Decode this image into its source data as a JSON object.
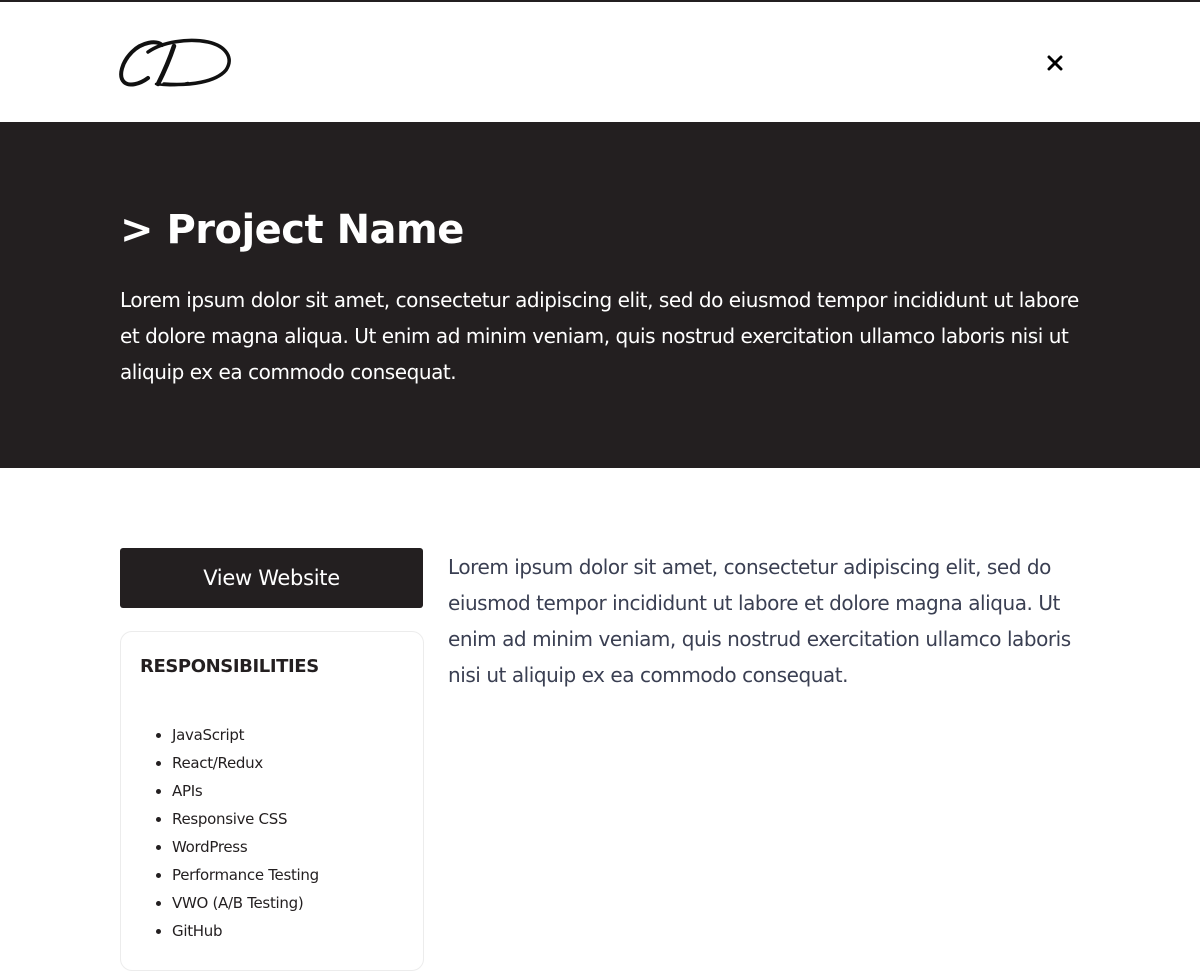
{
  "header": {
    "logo_text": "CD",
    "close_icon": "close-icon"
  },
  "hero": {
    "title": "> Project Name",
    "description": "Lorem ipsum dolor sit amet, consectetur adipiscing elit, sed do eiusmod tempor incididunt ut labore et dolore magna aliqua. Ut enim ad minim veniam, quis nostrud exercitation ullamco laboris nisi ut aliquip ex ea commodo consequat."
  },
  "sidebar": {
    "view_website_label": "View Website",
    "responsibilities_heading": "RESPONSIBILITIES",
    "responsibilities": [
      "JavaScript",
      "React/Redux",
      "APIs",
      "Responsive CSS",
      "WordPress",
      "Performance Testing",
      "VWO (A/B Testing)",
      "GitHub"
    ]
  },
  "main": {
    "body_text": "Lorem ipsum dolor sit amet, consectetur adipiscing elit, sed do eiusmod tempor incididunt ut labore et dolore magna aliqua. Ut enim ad minim veniam, quis nostrud exercitation ullamco laboris nisi ut aliquip ex ea commodo consequat."
  },
  "colors": {
    "dark": "#231f20",
    "background": "#ffffff",
    "body_text": "#3a3f52"
  }
}
